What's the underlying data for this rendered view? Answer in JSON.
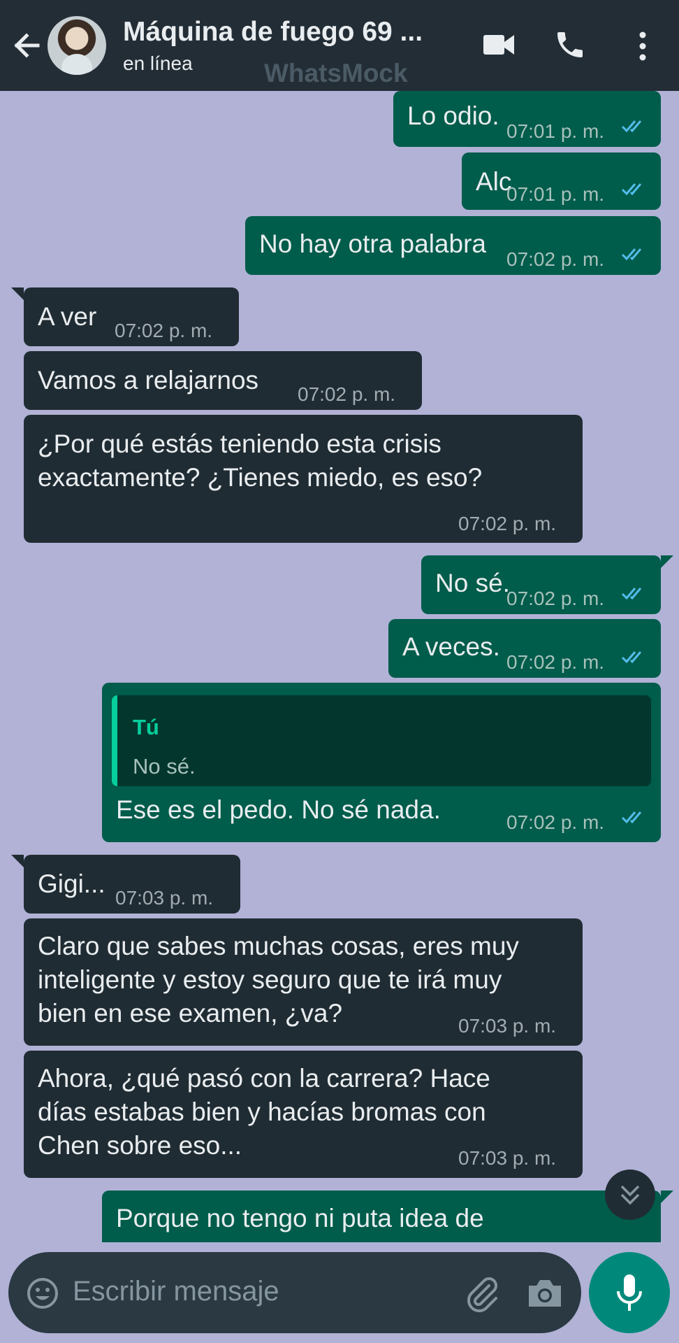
{
  "header": {
    "title": "Máquina de fuego 69 ...",
    "status": "en línea",
    "watermark": "WhatsMock"
  },
  "messages": [
    {
      "dir": "out",
      "text": "Lo odio.",
      "time": "07:01 p. m."
    },
    {
      "dir": "out",
      "text": "Alc",
      "time": "07:01 p. m."
    },
    {
      "dir": "out",
      "text": "No hay otra palabra",
      "time": "07:02 p. m."
    },
    {
      "dir": "in",
      "text": "A ver",
      "time": "07:02 p. m."
    },
    {
      "dir": "in",
      "text": "Vamos a relajarnos",
      "time": "07:02 p. m."
    },
    {
      "dir": "in",
      "line1": "¿Por qué estás teniendo esta crisis",
      "line2": "exactamente? ¿Tienes miedo, es eso?",
      "time": "07:02 p. m."
    },
    {
      "dir": "out",
      "text": "No sé.",
      "time": "07:02 p. m."
    },
    {
      "dir": "out",
      "text": "A veces.",
      "time": "07:02 p. m."
    },
    {
      "dir": "out",
      "quote_author": "Tú",
      "quote_text": "No sé.",
      "text": "Ese es el pedo. No sé nada.",
      "time": "07:02 p. m."
    },
    {
      "dir": "in",
      "text": "Gigi...",
      "time": "07:03 p. m."
    },
    {
      "dir": "in",
      "line1": "Claro que sabes muchas cosas, eres muy",
      "line2": "inteligente y estoy seguro que te irá muy",
      "line3": "bien en ese examen, ¿va?",
      "time": "07:03 p. m."
    },
    {
      "dir": "in",
      "line1": "Ahora, ¿qué pasó con la carrera? Hace",
      "line2": "días estabas bien y hacías bromas con",
      "line3": "Chen sobre eso...",
      "time": "07:03 p. m."
    },
    {
      "dir": "out",
      "text": "Porque no tengo ni puta idea de"
    }
  ],
  "composer": {
    "placeholder": "Escribir mensaje"
  },
  "colors": {
    "background": "#b1b2d6",
    "header": "#232d36",
    "outgoing": "#005c4b",
    "incoming": "#202c33",
    "read_ticks": "#53bdeb",
    "mic_button": "#00897b"
  },
  "icons": [
    "back-arrow-icon",
    "video-call-icon",
    "phone-icon",
    "more-vert-icon",
    "double-check-icon",
    "chevrons-down-icon",
    "emoji-icon",
    "attach-icon",
    "camera-icon",
    "mic-icon"
  ]
}
